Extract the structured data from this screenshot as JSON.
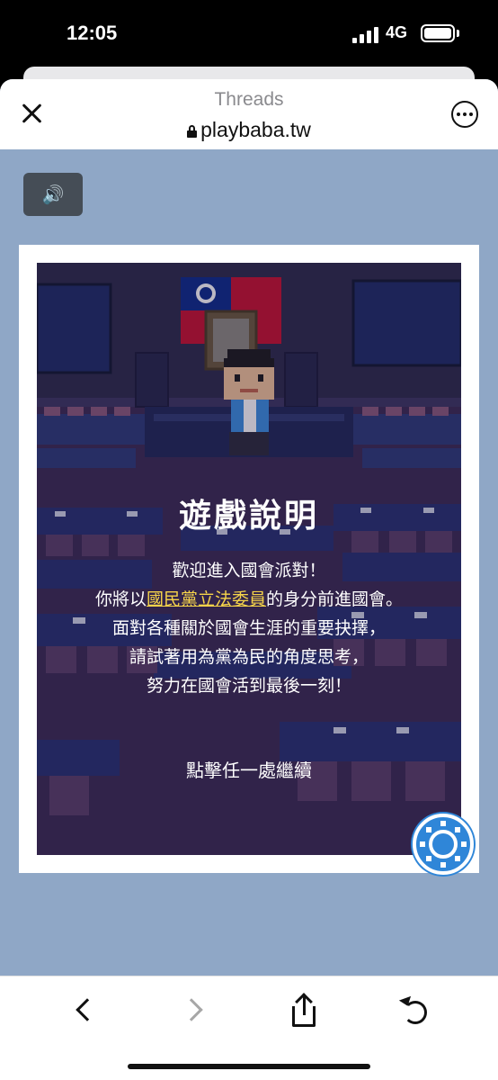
{
  "status_bar": {
    "time": "12:05",
    "network": "4G"
  },
  "header": {
    "title": "Threads",
    "url": "playbaba.tw"
  },
  "sound_button": {
    "icon": "speaker-icon",
    "glyph": "🔊"
  },
  "game": {
    "title": "遊戲說明",
    "line1": "歡迎進入國會派對！",
    "line2_before": "你將以",
    "line2_highlight": "國民黨立法委員",
    "line2_after": "的身分前進國會。",
    "line3": "面對各種關於國會生涯的重要抉擇，",
    "line4": "請試著用為黨為民的角度思考，",
    "line5": "努力在國會活到最後一刻！",
    "continue": "點擊任一處繼續",
    "highlight_color": "#f6d44a"
  },
  "toolbar": {
    "back": "back-icon",
    "forward": "forward-icon",
    "share": "share-icon",
    "reload": "reload-icon"
  },
  "colors": {
    "page_bg": "#8fa7c6",
    "scene_bg": "#2a1f45",
    "badge": "#2f86d8"
  }
}
